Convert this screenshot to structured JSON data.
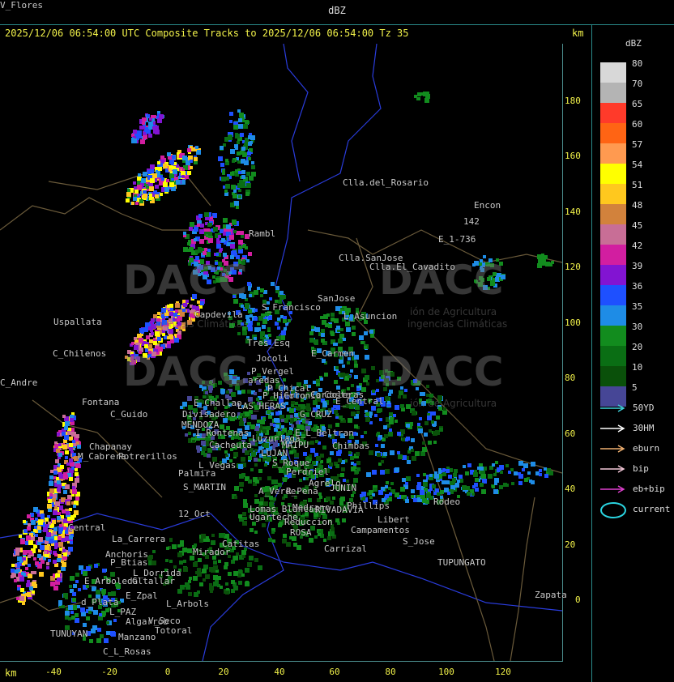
{
  "header": {
    "title": "dBZ",
    "subtitle": "2025/12/06 06:54:00 UTC Composite Tracks to 2025/12/06 06:54:00 Tz 35",
    "km_label": "km"
  },
  "axes": {
    "x_unit": "km",
    "y_unit": "km",
    "x_ticks": [
      "-40",
      "-20",
      "0",
      "20",
      "40",
      "60",
      "80",
      "100",
      "120"
    ],
    "y_ticks": [
      "180",
      "160",
      "140",
      "120",
      "100",
      "80",
      "60",
      "40",
      "20",
      "0"
    ]
  },
  "watermarks": {
    "brand_1": "DACC",
    "brand_2": "DACC",
    "brand_3": "DACC",
    "brand_4": "DACC",
    "sub_1": "ión de Agricultura",
    "sub_2": "ingencias Climáticas",
    "sub_3": "ión de Agricultura",
    "sub_4": "igencias Climáticas"
  },
  "places": [
    {
      "name": "Clla.del_Rosario"
    },
    {
      "name": "Encon"
    },
    {
      "name": "142"
    },
    {
      "name": "E_1-736"
    },
    {
      "name": "Rambl"
    },
    {
      "name": "Clla.SanJose"
    },
    {
      "name": "Clla.El_Cavadito"
    },
    {
      "name": "SanJose"
    },
    {
      "name": "Uspallata"
    },
    {
      "name": "Capdevila"
    },
    {
      "name": "S_Francisco"
    },
    {
      "name": "L_Asuncion"
    },
    {
      "name": "C_Chilenos"
    },
    {
      "name": "Tres_Esq"
    },
    {
      "name": "Jocoli"
    },
    {
      "name": "E_Carmen"
    },
    {
      "name": "C_Andre"
    },
    {
      "name": "aredas"
    },
    {
      "name": "P_Vergel"
    },
    {
      "name": "P_Chical"
    },
    {
      "name": "Colonia"
    },
    {
      "name": "Costa"
    },
    {
      "name": "Fontana"
    },
    {
      "name": "C_Guido"
    },
    {
      "name": "E_Challao"
    },
    {
      "name": "LAS_HERAS"
    },
    {
      "name": "P_Hierro"
    },
    {
      "name": "Cordoleras"
    },
    {
      "name": "E_Central"
    },
    {
      "name": "Divisadero"
    },
    {
      "name": "MENDOZA"
    },
    {
      "name": "G_CRUZ"
    },
    {
      "name": "I_Rontenas"
    },
    {
      "name": "Luzuriaga"
    },
    {
      "name": "E_L_Beltran"
    },
    {
      "name": "Chapanay"
    },
    {
      "name": "Potrerillos"
    },
    {
      "name": "Cacheuta"
    },
    {
      "name": "MAIPU"
    },
    {
      "name": "Chimbas"
    },
    {
      "name": "M_Cabrera"
    },
    {
      "name": "L_Vegas"
    },
    {
      "name": "LUJAN"
    },
    {
      "name": "S_Roque"
    },
    {
      "name": "Palmira"
    },
    {
      "name": "Perdriel"
    },
    {
      "name": "S_MARTIN"
    },
    {
      "name": "Agrelo"
    },
    {
      "name": "A_Verde"
    },
    {
      "name": "R_Pena"
    },
    {
      "name": "JUNIN"
    },
    {
      "name": "Rodeo"
    },
    {
      "name": "Lomas_Blancas"
    },
    {
      "name": "Medrano"
    },
    {
      "name": "RIVADAVIA"
    },
    {
      "name": "Phillips"
    },
    {
      "name": "12_Oct"
    },
    {
      "name": "Ugarteche"
    },
    {
      "name": "Reduccion"
    },
    {
      "name": "Libert"
    },
    {
      "name": "ROSA"
    },
    {
      "name": "Campamentos"
    },
    {
      "name": "Central"
    },
    {
      "name": "La_Carrera"
    },
    {
      "name": "S_Jose"
    },
    {
      "name": "Catitas"
    },
    {
      "name": "Carrizal"
    },
    {
      "name": "Mirador"
    },
    {
      "name": "Anchoris"
    },
    {
      "name": "P_Btias"
    },
    {
      "name": "TUPUNGATO"
    },
    {
      "name": "L_Dorrida"
    },
    {
      "name": "E_Arboleda"
    },
    {
      "name": "Gltallar"
    },
    {
      "name": "E_Zpal"
    },
    {
      "name": "d_Plata"
    },
    {
      "name": "L_Arbols"
    },
    {
      "name": "Zapata"
    },
    {
      "name": "L_PAZ"
    },
    {
      "name": "Algarrob"
    },
    {
      "name": "V_Seco"
    },
    {
      "name": "Totoral"
    },
    {
      "name": "TUNUYAN"
    },
    {
      "name": "Manzano"
    },
    {
      "name": "C_L_Rosas"
    },
    {
      "name": "V_Flores"
    }
  ],
  "legend": {
    "title": "dBZ",
    "levels": [
      {
        "value": "80",
        "color": "#d8d8d8"
      },
      {
        "value": "70",
        "color": "#b4b4b4"
      },
      {
        "value": "65",
        "color": "#ff3a2a"
      },
      {
        "value": "60",
        "color": "#ff6414"
      },
      {
        "value": "57",
        "color": "#ff9a50"
      },
      {
        "value": "54",
        "color": "#ffff00"
      },
      {
        "value": "51",
        "color": "#ffc81e"
      },
      {
        "value": "48",
        "color": "#d2823c"
      },
      {
        "value": "45",
        "color": "#c86e96"
      },
      {
        "value": "42",
        "color": "#d21ea0"
      },
      {
        "value": "39",
        "color": "#8214d2"
      },
      {
        "value": "36",
        "color": "#1e50ff"
      },
      {
        "value": "35",
        "color": "#1e8ce6"
      },
      {
        "value": "30",
        "color": "#128c1e"
      },
      {
        "value": "20",
        "color": "#0a6e14"
      },
      {
        "value": "10",
        "color": "#0a500a"
      },
      {
        "value": "5",
        "color": "#464696"
      }
    ],
    "tracks": [
      {
        "label": "50YD",
        "color": "#3ecfd8"
      },
      {
        "label": "30HM",
        "color": "#ffffff"
      },
      {
        "label": "eburn",
        "color": "#f0b070"
      },
      {
        "label": "bip",
        "color": "#f4c8d8"
      },
      {
        "label": "eb+bip",
        "color": "#e040d0"
      }
    ],
    "current_label": "current",
    "current_color": "#2ad4e0"
  }
}
